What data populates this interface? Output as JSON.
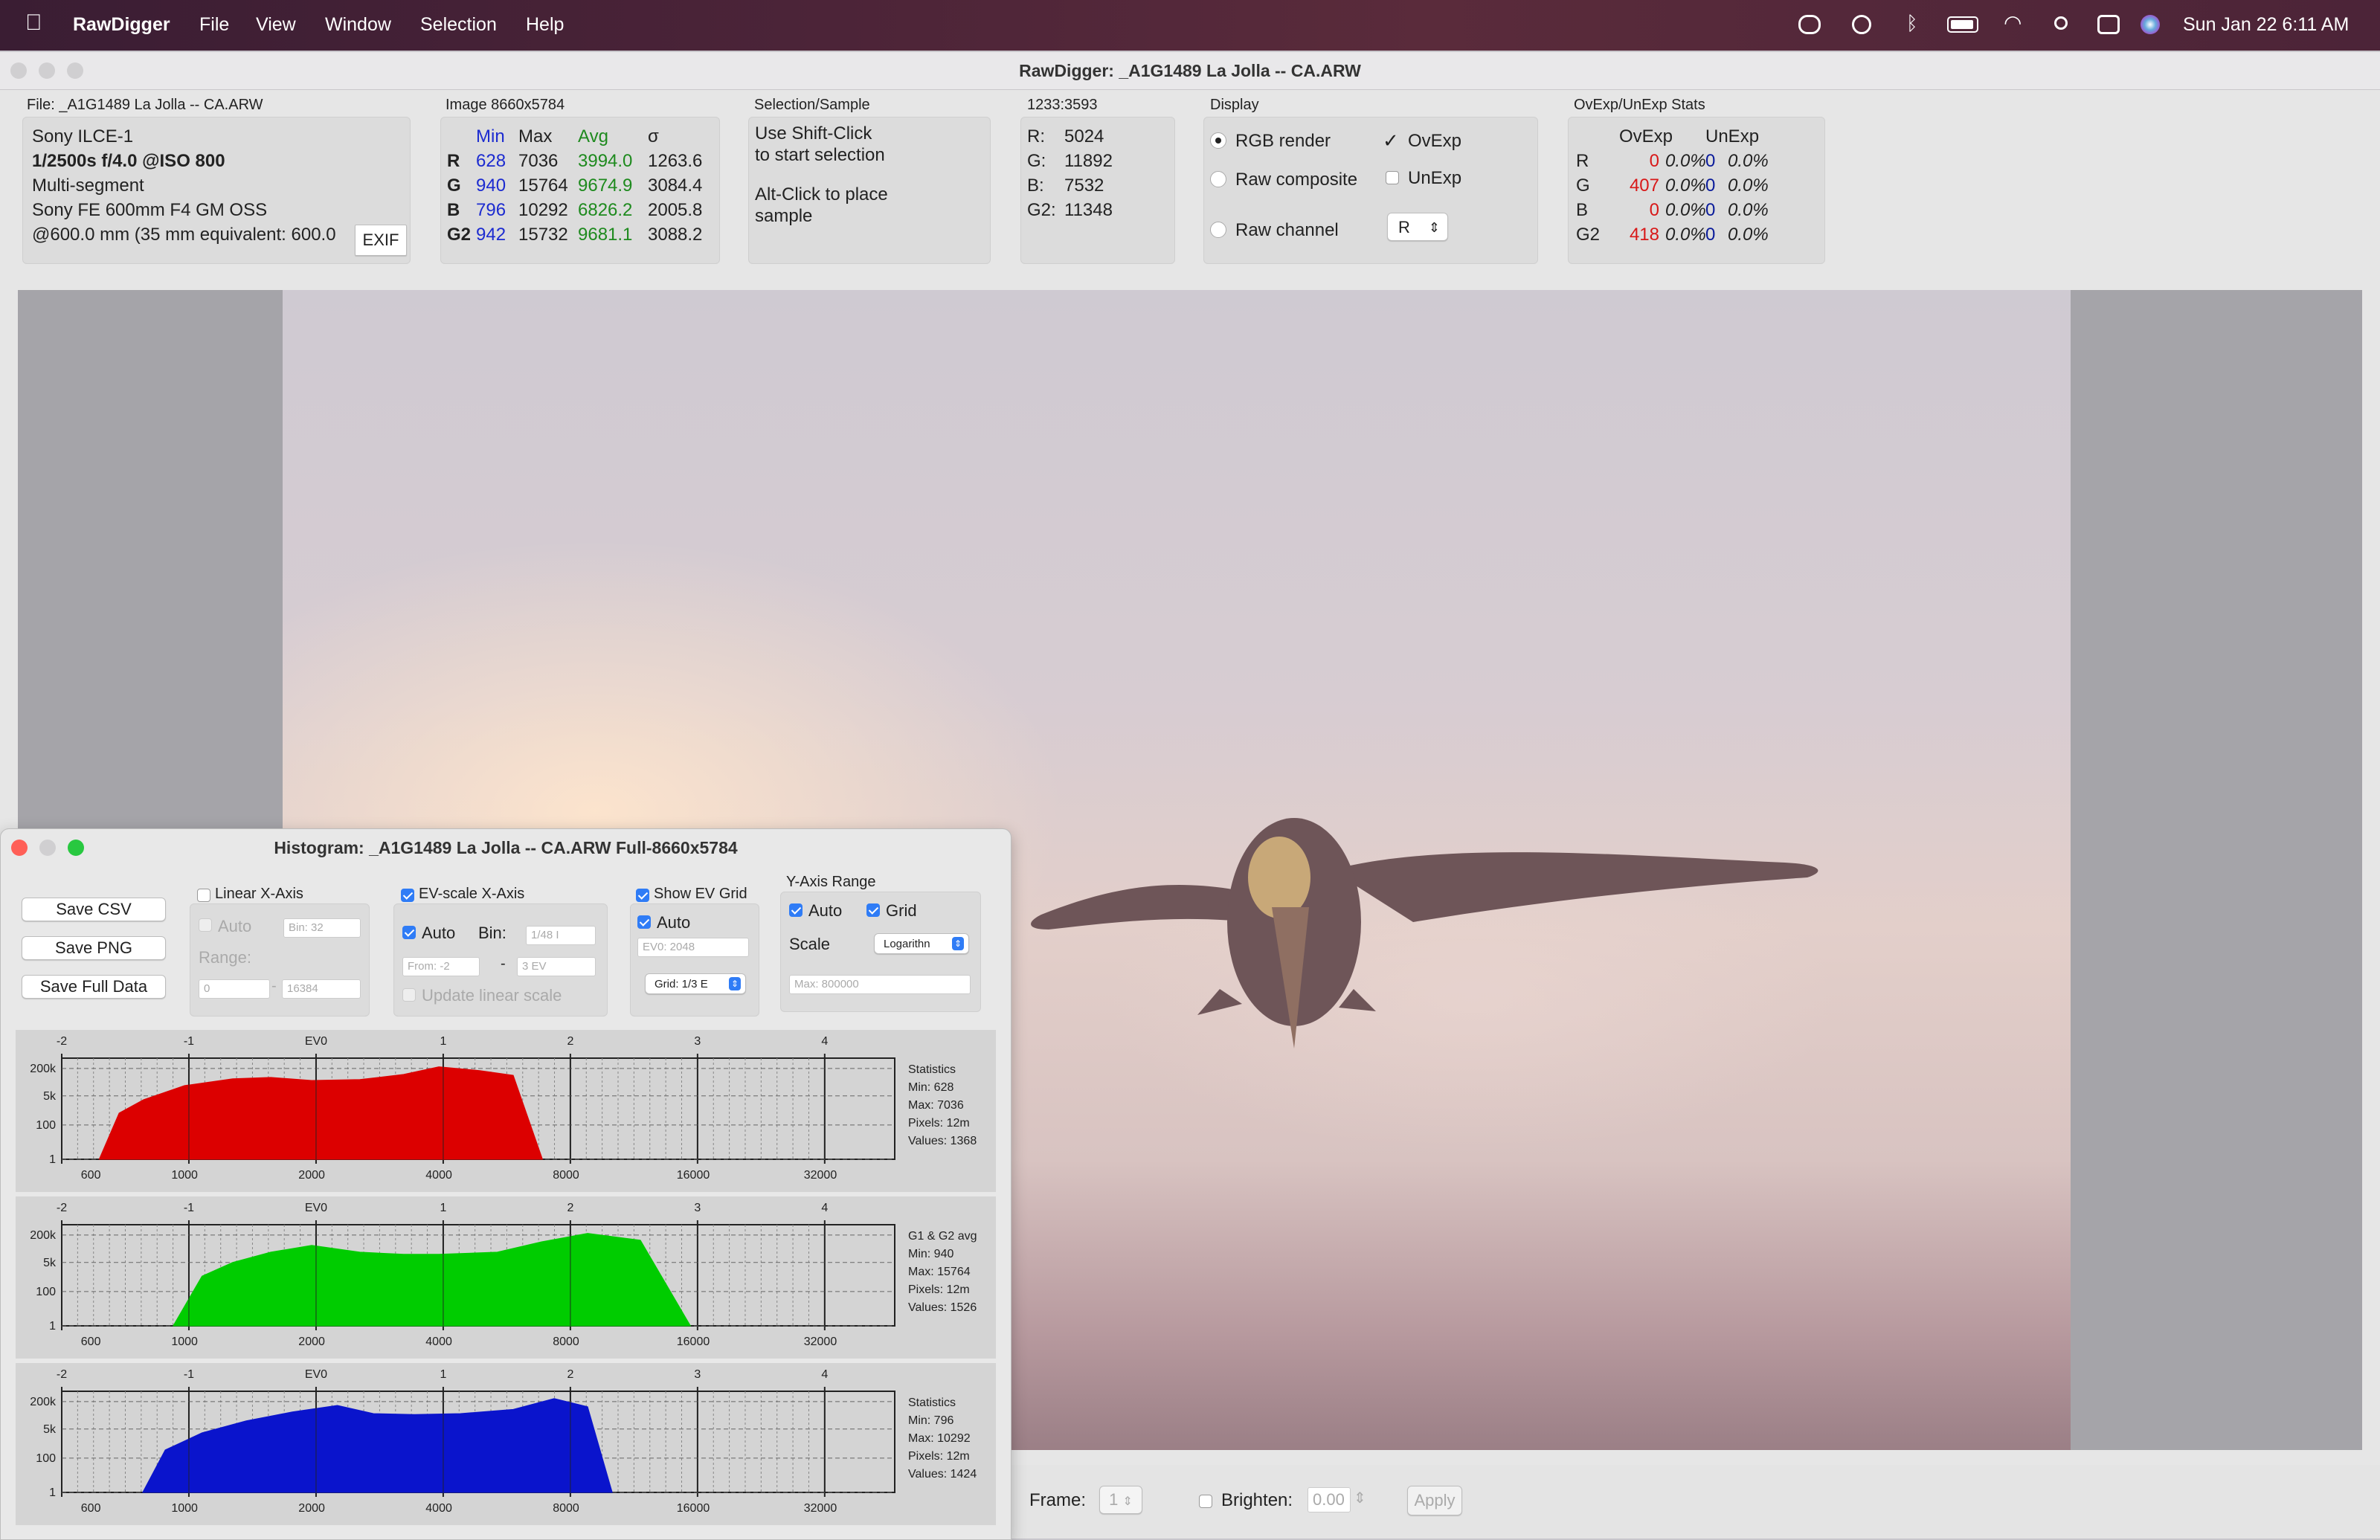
{
  "menubar": {
    "app": "RawDigger",
    "items": [
      "File",
      "View",
      "Window",
      "Selection",
      "Help"
    ],
    "datetime": "Sun Jan 22  6:11 AM"
  },
  "window": {
    "title": "RawDigger: _A1G1489 La Jolla -- CA.ARW"
  },
  "file_panel": {
    "label": "File: _A1G1489 La Jolla -- CA.ARW",
    "camera": "Sony ILCE-1",
    "exposure": "1/2500s f/4.0 @ISO 800",
    "mode": "Multi-segment",
    "lens": "Sony FE 600mm F4 GM OSS",
    "focal": "@600.0 mm (35 mm equivalent: 600.0",
    "exif_button": "EXIF"
  },
  "image_stats": {
    "label": "Image 8660x5784",
    "headers": [
      "Min",
      "Max",
      "Avg",
      "σ"
    ],
    "rows": [
      {
        "ch": "R",
        "min": "628",
        "max": "7036",
        "avg": "3994.0",
        "sd": "1263.6"
      },
      {
        "ch": "G",
        "min": "940",
        "max": "15764",
        "avg": "9674.9",
        "sd": "3084.4"
      },
      {
        "ch": "B",
        "min": "796",
        "max": "10292",
        "avg": "6826.2",
        "sd": "2005.8"
      },
      {
        "ch": "G2",
        "min": "942",
        "max": "15732",
        "avg": "9681.1",
        "sd": "3088.2"
      }
    ]
  },
  "selection": {
    "label": "Selection/Sample",
    "line1": "Use Shift-Click",
    "line2": "to start selection",
    "line3": "Alt-Click to place",
    "line4": "sample"
  },
  "sample": {
    "label": "1233:3593",
    "rows": [
      {
        "ch": "R:",
        "val": "5024"
      },
      {
        "ch": "G:",
        "val": "11892"
      },
      {
        "ch": "B:",
        "val": "7532"
      },
      {
        "ch": "G2:",
        "val": "11348"
      }
    ]
  },
  "display": {
    "label": "Display",
    "rgb_render": "RGB render",
    "raw_composite": "Raw composite",
    "raw_channel": "Raw channel",
    "ovexp": "OvExp",
    "unexp": "UnExp",
    "channel_select": "R"
  },
  "ovexp_stats": {
    "label": "OvExp/UnExp Stats",
    "headers": [
      "OvExp",
      "UnExp"
    ],
    "rows": [
      {
        "ch": "R",
        "ov": "0",
        "ovp": "0.0%",
        "un": "0",
        "unp": "0.0%"
      },
      {
        "ch": "G",
        "ov": "407",
        "ovp": "0.0%",
        "un": "0",
        "unp": "0.0%"
      },
      {
        "ch": "B",
        "ov": "0",
        "ovp": "0.0%",
        "un": "0",
        "unp": "0.0%"
      },
      {
        "ch": "G2",
        "ov": "418",
        "ovp": "0.0%",
        "un": "0",
        "unp": "0.0%"
      }
    ]
  },
  "status": {
    "frame_label": "Frame:",
    "frame_value": "1",
    "brighten_label": "Brighten:",
    "brighten_value": "0.00",
    "apply": "Apply"
  },
  "histogram": {
    "title": "Histogram: _A1G1489 La Jolla -- CA.ARW Full-8660x5784",
    "save_csv": "Save CSV",
    "save_png": "Save PNG",
    "save_full": "Save Full Data",
    "linear_x": "Linear X-Axis",
    "auto": "Auto",
    "bin_label": "Bin:",
    "bin_32": "Bin: 32",
    "range_label": "Range:",
    "range_from": "0",
    "range_to": "16384",
    "ev_scale": "EV-scale X-Axis",
    "ev_bin": "1/48 I",
    "ev_from": "From: -2",
    "ev_to": "3 EV",
    "update_linear": "Update linear scale",
    "show_ev_grid": "Show EV Grid",
    "ev0": "EV0: 2048",
    "grid": "Grid: 1/3 E",
    "y_range": "Y-Axis Range",
    "grid_label": "Grid",
    "scale_label": "Scale",
    "scale_value": "Logarithn",
    "max_label": "Max: 800000"
  },
  "chart_data": [
    {
      "type": "area",
      "name": "R",
      "color": "#dc0000",
      "top_labels": [
        "-2",
        "-1",
        "EV0",
        "1",
        "2",
        "3",
        "4"
      ],
      "bottom_labels": [
        "600",
        "1000",
        "2000",
        "4000",
        "8000",
        "16000",
        "32000"
      ],
      "y_labels": [
        "200k",
        "5k",
        "100",
        "1"
      ],
      "stats_title": "Statistics",
      "stats": [
        "Min: 628",
        "Max: 7036",
        "Pixels: 12m",
        "Values: 1368"
      ],
      "x": [
        628,
        700,
        800,
        1000,
        1300,
        1600,
        2000,
        2600,
        3300,
        4000,
        5000,
        6000,
        7036
      ],
      "y": [
        1,
        500,
        3000,
        20000,
        50000,
        60000,
        40000,
        45000,
        90000,
        250000,
        150000,
        80000,
        1
      ]
    },
    {
      "type": "area",
      "name": "G1 & G2 avg",
      "color": "#00cc00",
      "top_labels": [
        "-2",
        "-1",
        "EV0",
        "1",
        "2",
        "3",
        "4"
      ],
      "bottom_labels": [
        "600",
        "1000",
        "2000",
        "4000",
        "8000",
        "16000",
        "32000"
      ],
      "y_labels": [
        "200k",
        "5k",
        "100",
        "1"
      ],
      "stats_title": "G1 & G2 avg",
      "stats": [
        "Min: 940",
        "Max: 15764",
        "Pixels: 12m",
        "Values: 1526"
      ],
      "x": [
        940,
        1100,
        1300,
        1600,
        2000,
        2600,
        3300,
        4000,
        5500,
        7000,
        9000,
        12000,
        15764
      ],
      "y": [
        1,
        800,
        5000,
        20000,
        50000,
        20000,
        15000,
        15000,
        20000,
        80000,
        250000,
        100000,
        1
      ]
    },
    {
      "type": "area",
      "name": "B",
      "color": "#0a14cc",
      "top_labels": [
        "-2",
        "-1",
        "EV0",
        "1",
        "2",
        "3",
        "4"
      ],
      "bottom_labels": [
        "600",
        "1000",
        "2000",
        "4000",
        "8000",
        "16000",
        "32000"
      ],
      "y_labels": [
        "200k",
        "5k",
        "100",
        "1"
      ],
      "stats_title": "Statistics",
      "stats": [
        "Min: 796",
        "Max: 10292",
        "Pixels: 12m",
        "Values: 1424"
      ],
      "x": [
        796,
        900,
        1100,
        1400,
        1800,
        2300,
        2800,
        3500,
        4500,
        6000,
        7500,
        9000,
        10292
      ],
      "y": [
        1,
        300,
        3000,
        15000,
        50000,
        120000,
        40000,
        35000,
        40000,
        70000,
        300000,
        100000,
        1
      ]
    }
  ]
}
